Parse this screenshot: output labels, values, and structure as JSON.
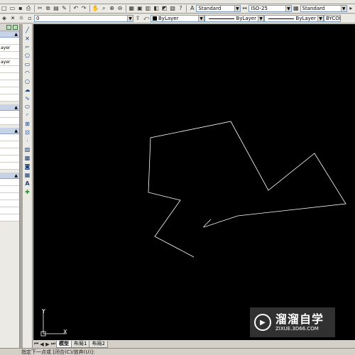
{
  "toolbar": {
    "text_style": "Standard",
    "dim_style": "ISO-25",
    "table_style": "Standard",
    "layer_value": "0",
    "color": "ByLayer",
    "linetype": "ByLayer",
    "lineweight": "ByLayer",
    "plot_style": "BYCOL"
  },
  "palette": {
    "rows": [
      "",
      "ayer",
      "",
      "ayer",
      "",
      "",
      "",
      "",
      "",
      "",
      "",
      "",
      "",
      "",
      "",
      "",
      "",
      "",
      "",
      "",
      "",
      ""
    ]
  },
  "vtool_icons": [
    "line-icon",
    "xline-icon",
    "polyline-icon",
    "polygon-icon",
    "rectangle-icon",
    "arc-icon",
    "circle-icon",
    "revcloud-icon",
    "spline-icon",
    "ellipse-icon",
    "ellipse-arc-icon",
    "insert-block-icon",
    "make-block-icon",
    "point-icon",
    "hatch-icon",
    "gradient-icon",
    "region-icon",
    "table-icon",
    "mtext-icon",
    "add-selected-icon"
  ],
  "tabs": [
    "模型",
    "布局1",
    "布局2"
  ],
  "command": {
    "prompt": "指定下一点或 [闭合(C)/放弃(U)]:"
  },
  "ucs": {
    "x_label": "X",
    "y_label": "Y"
  },
  "watermark": {
    "title": "溜溜自学",
    "url": "ZIXUE.3D66.COM"
  },
  "colors": {
    "canvas": "#000000",
    "polyline": "#ffffff",
    "watermark_bg": "#3c3c3c"
  }
}
